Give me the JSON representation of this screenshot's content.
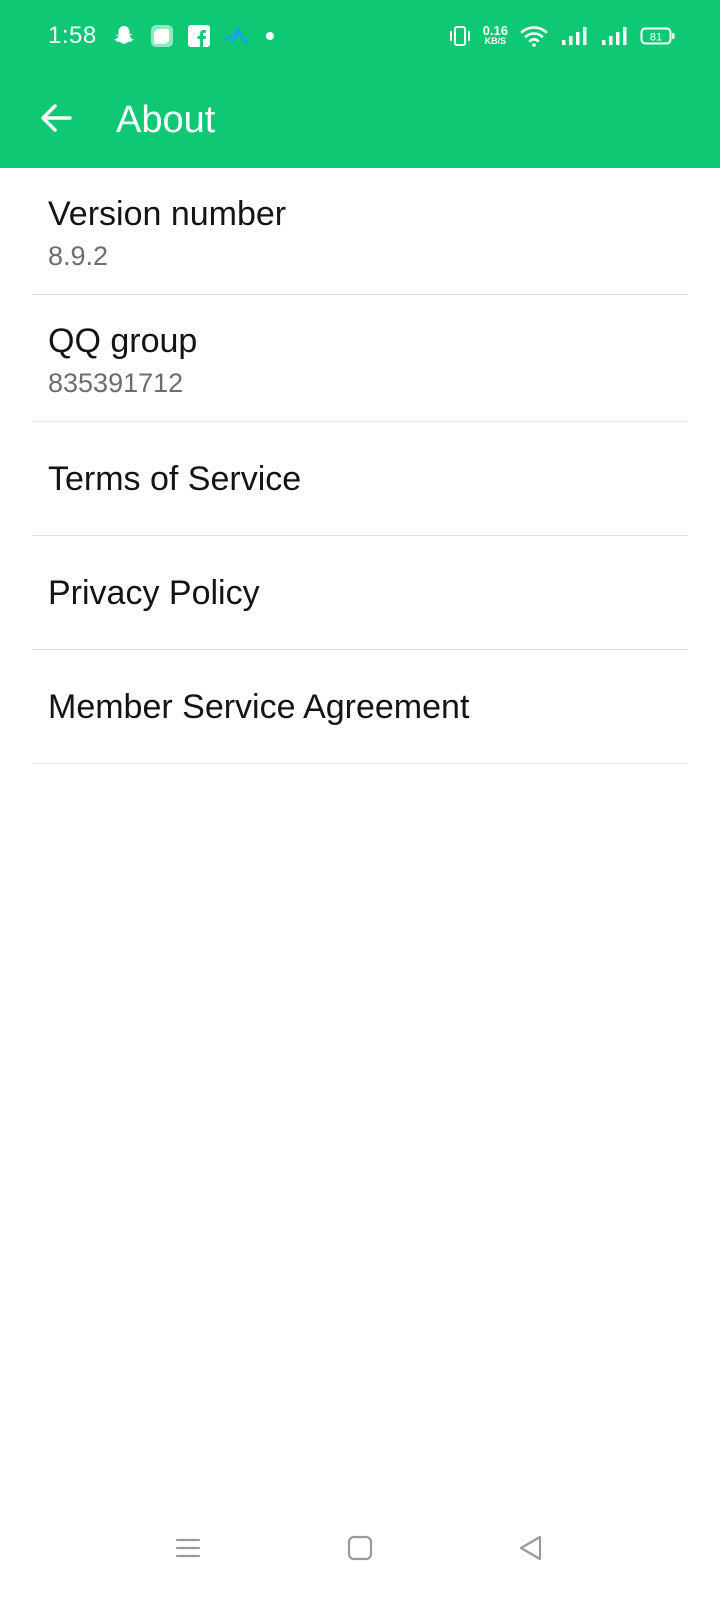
{
  "status_bar": {
    "time": "1:58",
    "net_speed_value": "0.16",
    "net_speed_unit": "KB/S",
    "battery": "81",
    "left_icons": [
      "snapchat-icon",
      "app-icon",
      "facebook-icon",
      "telenor-icon",
      "dot-icon"
    ],
    "right_icons": [
      "vibrate-icon",
      "wifi-icon",
      "signal-icon",
      "signal-icon",
      "battery-icon"
    ]
  },
  "app_bar": {
    "back_icon": "arrow-left-icon",
    "title": "About"
  },
  "settings": {
    "items": [
      {
        "title": "Version number",
        "subtitle": "8.9.2"
      },
      {
        "title": "QQ group",
        "subtitle": "835391712"
      },
      {
        "title": "Terms of Service"
      },
      {
        "title": "Privacy Policy"
      },
      {
        "title": "Member Service Agreement"
      }
    ]
  },
  "nav_bar": {
    "icons": [
      "menu-icon",
      "home-square-icon",
      "back-triangle-icon"
    ]
  },
  "colors": {
    "accent": "#0fc874",
    "title_text": "#141414",
    "subtitle_text": "#6d6d6d",
    "divider": "#e3e3e3",
    "nav_icons": "#9a9a9a"
  }
}
